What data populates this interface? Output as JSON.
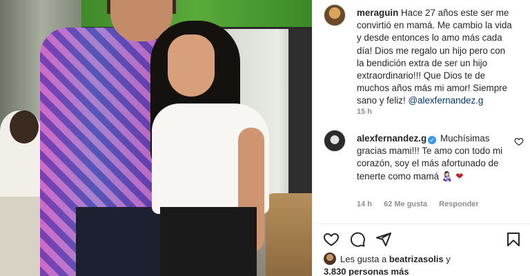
{
  "post": {
    "author": "meraguin",
    "caption": "Hace 27 años este ser me convirtió en mamá. Me cambio la vida y desde entonces lo amo más cada día! Dios me regalo un hijo pero con la bendición extra de ser un hijo extraordinario!!! Que Dios te de muchos años más mi amor! Siempre sano y feliz!",
    "mention": "@alexfernandez.g",
    "time": "15 h"
  },
  "reply": {
    "author": "alexfernandez.g",
    "text": "Muchísimas gracias mami!!! Te amo con todo mi corazón, soy el más afortunado de tenerte como mamá",
    "emoji": "👩🏻‍🍼",
    "heart": "❤",
    "time": "14 h",
    "likes": "62 Me gusta",
    "reply_label": "Responder"
  },
  "actions": [
    "like-icon",
    "comment-icon",
    "share-icon",
    "save-icon"
  ],
  "liked_by": {
    "prefix": "Les gusta a",
    "user": "beatrizasolis",
    "conj": "y",
    "others": "3.830 personas más"
  },
  "colors": {
    "link": "#00376b",
    "muted": "#8e8e8e",
    "verified": "#3897f0",
    "heart": "#c4202d"
  }
}
